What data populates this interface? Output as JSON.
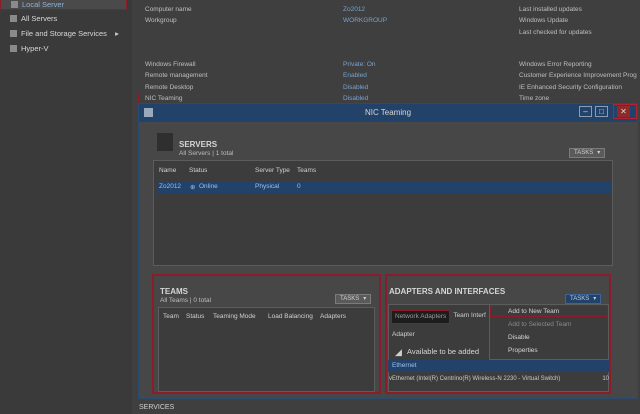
{
  "sidebar": {
    "items": [
      {
        "label": "Local Server"
      },
      {
        "label": "All Servers"
      },
      {
        "label": "File and Storage Services"
      },
      {
        "label": "Hyper-V"
      }
    ]
  },
  "properties": {
    "computer_name_label": "Computer name",
    "computer_name_value": "Zo2012",
    "workgroup_label": "Workgroup",
    "workgroup_value": "WORKGROUP",
    "firewall_label": "Windows Firewall",
    "firewall_value": "Private: On",
    "remote_mgmt_label": "Remote management",
    "remote_mgmt_value": "Enabled",
    "remote_desktop_label": "Remote Desktop",
    "remote_desktop_value": "Disabled",
    "nic_teaming_label": "NIC Teaming",
    "nic_teaming_value": "Disabled",
    "right_col": [
      "Last installed updates",
      "Windows Update",
      "Last checked for updates",
      "Windows Error Reporting",
      "Customer Experience Improvement Prog",
      "IE Enhanced Security Configuration",
      "Time zone"
    ]
  },
  "nic_window": {
    "title": "NIC Teaming",
    "servers": {
      "title": "SERVERS",
      "subtitle": "All Servers | 1 total",
      "tasks": "TASKS",
      "columns": [
        "Name",
        "Status",
        "Server Type",
        "Teams"
      ],
      "row": {
        "name": "Zo2012",
        "status": "Online",
        "type": "Physical",
        "teams": "0"
      }
    },
    "teams": {
      "title": "TEAMS",
      "subtitle": "All Teams | 0 total",
      "tasks": "TASKS",
      "columns": [
        "Team",
        "Status",
        "Teaming Mode",
        "Load Balancing",
        "Adapters"
      ]
    },
    "adapters": {
      "title": "ADAPTERS AND INTERFACES",
      "tasks": "TASKS",
      "tab_network": "Network Adapters",
      "tab_team": "Team Interf",
      "adapter_header": "Adapter",
      "available": "Available to be added",
      "ethernet": "Ethernet",
      "vethernet": "vEthernet (Intel(R) Centrino(R) Wireless-N 2230 - Virtual Switch)",
      "speed": "10"
    },
    "menu": {
      "add_new": "Add to New Team",
      "add_selected": "Add to Selected Team",
      "disable": "Disable",
      "properties": "Properties"
    }
  },
  "bottom": "SERVICES"
}
